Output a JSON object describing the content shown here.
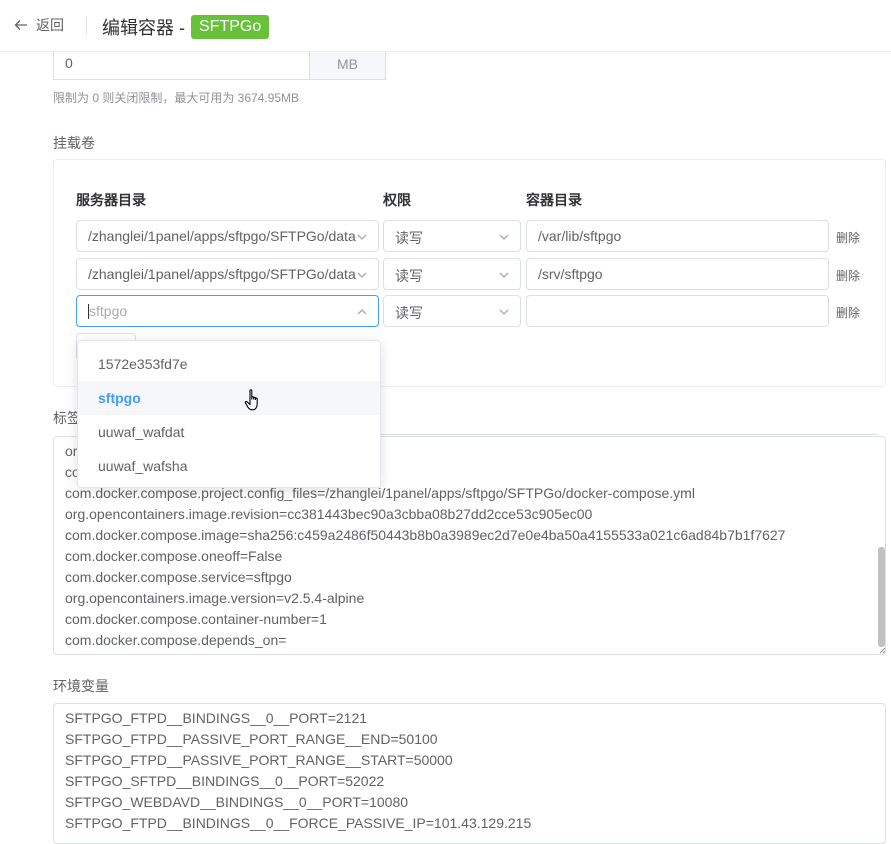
{
  "header": {
    "back_label": "返回",
    "title": "编辑容器 -",
    "tag": "SFTPGo",
    "tag_color": "#67c23a"
  },
  "memory": {
    "value": "0",
    "unit": "MB",
    "hint": "限制为 0 则关闭限制，最大可用为 3674.95MB"
  },
  "volumes": {
    "label": "挂载卷",
    "columns": {
      "host": "服务器目录",
      "perm": "权限",
      "container": "容器目录"
    },
    "rows": [
      {
        "host": "/zhanglei/1panel/apps/sftpgo/SFTPGo/data",
        "perm": "读写",
        "container": "/var/lib/sftpgo",
        "delete": "删除"
      },
      {
        "host": "/zhanglei/1panel/apps/sftpgo/SFTPGo/data",
        "perm": "读写",
        "container": "/srv/sftpgo",
        "delete": "删除"
      },
      {
        "host_placeholder": "sftpgo",
        "perm": "读写",
        "container": "",
        "delete": "删除"
      }
    ],
    "dropdown_options": [
      "1572e353fd7e",
      "sftpgo",
      "uuwaf_wafdat",
      "uuwaf_wafsha"
    ],
    "dropdown_selected": "sftpgo"
  },
  "labels": {
    "label": "标签",
    "lines": [
      "or",
      "co",
      "com.docker.compose.project.config_files=/zhanglei/1panel/apps/sftpgo/SFTPGo/docker-compose.yml",
      "org.opencontainers.image.revision=cc381443bec90a3cbba08b27dd2cce53c905ec00",
      "com.docker.compose.image=sha256:c459a2486f50443b8b0a3989ec2d7e0e4ba50a4155533a021c6ad84b7b1f7627",
      "com.docker.compose.oneoff=False",
      "com.docker.compose.service=sftpgo",
      "org.opencontainers.image.version=v2.5.4-alpine",
      "com.docker.compose.container-number=1",
      "com.docker.compose.depends_on="
    ]
  },
  "env": {
    "label": "环境变量",
    "lines": [
      "SFTPGO_FTPD__BINDINGS__0__PORT=2121",
      "SFTPGO_FTPD__PASSIVE_PORT_RANGE__END=50100",
      "SFTPGO_FTPD__PASSIVE_PORT_RANGE__START=50000",
      "SFTPGO_SFTPD__BINDINGS__0__PORT=52022",
      "SFTPGO_WEBDAVD__BINDINGS__0__PORT=10080",
      "SFTPGO_FTPD__BINDINGS__0__FORCE_PASSIVE_IP=101.43.129.215"
    ]
  },
  "colors": {
    "primary": "#409eff",
    "border": "#dcdfe6",
    "text": "#606266"
  }
}
